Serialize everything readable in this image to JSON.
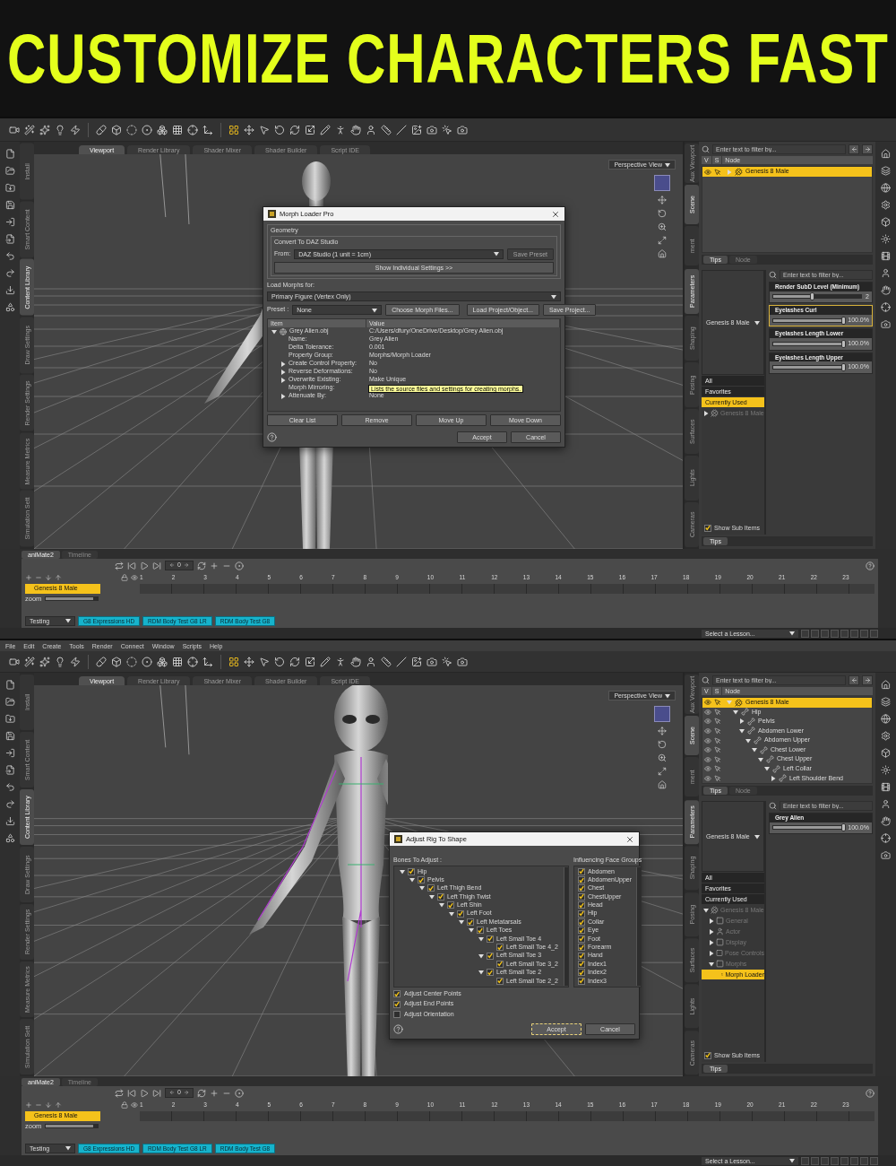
{
  "headline": "CUSTOMIZE CHARACTERS FAST",
  "screens": [
    {
      "left_tabs": [
        {
          "label": "Install",
          "selected": false
        },
        {
          "label": "Smart Content",
          "selected": false
        },
        {
          "label": "Content Library",
          "selected": true
        },
        {
          "label": "Draw Settings",
          "selected": false
        },
        {
          "label": "Render Settings",
          "selected": false
        },
        {
          "label": "Measure Metrics",
          "selected": false
        },
        {
          "label": "Simulation Sett",
          "selected": false
        }
      ],
      "viewport": {
        "tabs": [
          {
            "label": "Viewport",
            "selected": true
          },
          {
            "label": "Render Library",
            "selected": false
          },
          {
            "label": "Shader Mixer",
            "selected": false
          },
          {
            "label": "Shader Builder",
            "selected": false
          },
          {
            "label": "Script IDE",
            "selected": false
          }
        ],
        "view_label": "Perspective View",
        "kind": "human",
        "dialog": {
          "kind": "morph_loader",
          "title": "Morph Loader Pro",
          "geometry_label": "Geometry",
          "convert_label": "Convert To DAZ Studio",
          "from_label": "From:",
          "from_select": "DAZ Studio (1 unit = 1cm)",
          "save_preset": {
            "label": "Save Preset",
            "disabled": true
          },
          "show_settings": "Show Individual Settings >>",
          "load_for_label": "Load Morphs for:",
          "load_for_select": "Primary Figure (Vertex Only)",
          "preset_label": "Preset :",
          "preset_select": "None",
          "top_buttons": [
            "Choose Morph Files...",
            "Load Project/Object...",
            "Save Project..."
          ],
          "columns": [
            "Item",
            "Value"
          ],
          "rows": [
            {
              "item": "Grey Alien.obj",
              "value": "C:/Users/dfury/OneDrive/Desktop/Grey Alien.obj",
              "expanded": true,
              "children": [
                {
                  "item": "Name:",
                  "value": "Grey Alien"
                },
                {
                  "item": "Delta Tolerance:",
                  "value": "0.001"
                },
                {
                  "item": "Property Group:",
                  "value": "Morphs/Morph Loader"
                },
                {
                  "item": "Create Control Property:",
                  "value": "No",
                  "expanded": false
                },
                {
                  "item": "Reverse Deformations:",
                  "value": "No",
                  "expanded": false
                },
                {
                  "item": "Overwrite Existing:",
                  "value": "Make Unique",
                  "expanded": false
                },
                {
                  "item": "Morph Mirroring:"
                },
                {
                  "item": "Attenuate By:",
                  "value": "None",
                  "expanded": false
                }
              ]
            }
          ],
          "tooltip": "Lists the source files and settings for creating morphs.",
          "list_buttons": [
            "Clear List",
            "Remove",
            "Move Up",
            "Move Down"
          ],
          "accept": "Accept",
          "cancel": "Cancel"
        }
      },
      "right_panel": {
        "top_tabs": [
          {
            "label": "Aux Viewport",
            "selected": false
          },
          {
            "label": "Scene",
            "selected": true
          },
          {
            "label": "ment",
            "selected": false
          }
        ],
        "bottom_tabs": [
          {
            "label": "Parameters",
            "selected": true
          },
          {
            "label": "Shaping",
            "selected": false
          },
          {
            "label": "Posing",
            "selected": false
          },
          {
            "label": "Surfaces",
            "selected": false
          },
          {
            "label": "Lights",
            "selected": false
          },
          {
            "label": "Cameras",
            "selected": false
          }
        ],
        "scene": {
          "filter_placeholder": "Enter text to filter by...",
          "columns": [
            "V",
            "S",
            "Node"
          ],
          "nodes": [
            {
              "label": "Genesis 8 Male",
              "kind": "figure",
              "selected": true,
              "expanded": false
            }
          ]
        },
        "scene_tabs": [
          {
            "label": "Tips",
            "selected": true
          },
          {
            "label": "Node",
            "selected": false
          }
        ],
        "parameters": {
          "figure_select": "Genesis 8 Male",
          "categories": [
            {
              "label": "All",
              "selected": false
            },
            {
              "label": "Favorites",
              "selected": false
            },
            {
              "label": "Currently Used",
              "selected": true
            }
          ],
          "tree": [
            {
              "label": "Genesis 8 Male",
              "kind": "figure",
              "selected": false,
              "expanded": false
            }
          ],
          "filter_placeholder": "Enter text to filter by...",
          "sliders": [
            {
              "label": "Render SubD Level (Minimum)",
              "reading": "2",
              "level": 0.45,
              "selected": false
            },
            {
              "label": "Eyelashes Curl",
              "reading": "100.0%",
              "level": 1,
              "selected": true
            },
            {
              "label": "Eyelashes Length Lower",
              "reading": "100.0%",
              "level": 1,
              "selected": false
            },
            {
              "label": "Eyelashes Length Upper",
              "reading": "100.0%",
              "level": 1,
              "selected": false
            }
          ],
          "show_sub_items": {
            "label": "Show Sub Items",
            "checked": true
          },
          "bottom_tab": "Tips"
        }
      },
      "timeline": {
        "tabs": [
          {
            "label": "aniMate2",
            "selected": true
          },
          {
            "label": "Timeline",
            "selected": false
          }
        ],
        "frame": "0",
        "ticks": [
          "1",
          "2",
          "3",
          "4",
          "5",
          "6",
          "7",
          "8",
          "9",
          "10",
          "11",
          "12",
          "13",
          "14",
          "15",
          "16",
          "17",
          "18",
          "19",
          "20",
          "21",
          "22",
          "23"
        ],
        "track": "Genesis 8 Male",
        "zoom": {
          "label": "zoom",
          "level": 0.9
        },
        "set_select": "Testing",
        "clips": [
          "G8 Expressions HD",
          "RDM Body Test G8 LR",
          "RDM Body Test G8"
        ]
      },
      "status": {
        "lesson_select": "Select a Lesson..."
      }
    },
    {
      "menu": [
        "File",
        "Edit",
        "Create",
        "Tools",
        "Render",
        "Connect",
        "Window",
        "Scripts",
        "Help"
      ],
      "left_tabs": [
        {
          "label": "Install",
          "selected": false
        },
        {
          "label": "Smart Content",
          "selected": false
        },
        {
          "label": "Content Library",
          "selected": true
        },
        {
          "label": "Draw Settings",
          "selected": false
        },
        {
          "label": "Render Settings",
          "selected": false
        },
        {
          "label": "Measure Metrics",
          "selected": false
        },
        {
          "label": "Simulation Sett",
          "selected": false
        }
      ],
      "viewport": {
        "tabs": [
          {
            "label": "Viewport",
            "selected": true
          },
          {
            "label": "Render Library",
            "selected": false
          },
          {
            "label": "Shader Mixer",
            "selected": false
          },
          {
            "label": "Shader Builder",
            "selected": false
          },
          {
            "label": "Script IDE",
            "selected": false
          }
        ],
        "view_label": "Perspective View",
        "kind": "alien",
        "dialog": {
          "kind": "adjust_rig",
          "title": "Adjust Rig To Shape",
          "bones_label": "Bones To Adjust :",
          "bones": [
            {
              "label": "Hip",
              "checked": true,
              "expanded": true,
              "children": [
                {
                  "label": "Pelvis",
                  "checked": true,
                  "expanded": true,
                  "children": [
                    {
                      "label": "Left Thigh Bend",
                      "checked": true,
                      "expanded": true,
                      "children": [
                        {
                          "label": "Left Thigh Twist",
                          "checked": true,
                          "expanded": true,
                          "children": [
                            {
                              "label": "Left Shin",
                              "checked": true,
                              "expanded": true,
                              "children": [
                                {
                                  "label": "Left Foot",
                                  "checked": true,
                                  "expanded": true,
                                  "children": [
                                    {
                                      "label": "Left Metatarsals",
                                      "checked": true,
                                      "expanded": true,
                                      "children": [
                                        {
                                          "label": "Left Toes",
                                          "checked": true,
                                          "expanded": true,
                                          "children": [
                                            {
                                              "label": "Left Small Toe 4",
                                              "checked": true,
                                              "expanded": true,
                                              "children": [
                                                {
                                                  "label": "Left Small Toe 4_2",
                                                  "checked": true
                                                }
                                              ]
                                            },
                                            {
                                              "label": "Left Small Toe 3",
                                              "checked": true,
                                              "expanded": true,
                                              "children": [
                                                {
                                                  "label": "Left Small Toe 3_2",
                                                  "checked": true
                                                }
                                              ]
                                            },
                                            {
                                              "label": "Left Small Toe 2",
                                              "checked": true,
                                              "expanded": true,
                                              "children": [
                                                {
                                                  "label": "Left Small Toe 2_2",
                                                  "checked": true
                                                }
                                              ]
                                            }
                                          ]
                                        }
                                      ]
                                    }
                                  ]
                                }
                              ]
                            }
                          ]
                        }
                      ]
                    }
                  ]
                }
              ]
            }
          ],
          "groups_label": "Influencing Face Groups",
          "groups": [
            {
              "label": "Abdomen",
              "checked": true
            },
            {
              "label": "AbdomenUpper",
              "checked": true
            },
            {
              "label": "Chest",
              "checked": true
            },
            {
              "label": "ChestUpper",
              "checked": true
            },
            {
              "label": "Head",
              "checked": true
            },
            {
              "label": "Hip",
              "checked": true
            },
            {
              "label": "Collar",
              "checked": true
            },
            {
              "label": "Eye",
              "checked": true
            },
            {
              "label": "Foot",
              "checked": true
            },
            {
              "label": "Forearm",
              "checked": true
            },
            {
              "label": "Hand",
              "checked": true
            },
            {
              "label": "Index1",
              "checked": true
            },
            {
              "label": "Index2",
              "checked": true
            },
            {
              "label": "Index3",
              "checked": true
            }
          ],
          "options": [
            {
              "label": "Adjust Center Points",
              "checked": true
            },
            {
              "label": "Adjust End Points",
              "checked": true
            },
            {
              "label": "Adjust Orientation",
              "checked": false
            }
          ],
          "accept": "Accept",
          "cancel": "Cancel"
        }
      },
      "right_panel": {
        "top_tabs": [
          {
            "label": "Aux Viewport",
            "selected": false
          },
          {
            "label": "Scene",
            "selected": true
          },
          {
            "label": "ment",
            "selected": false
          }
        ],
        "bottom_tabs": [
          {
            "label": "Parameters",
            "selected": true
          },
          {
            "label": "Shaping",
            "selected": false
          },
          {
            "label": "Posing",
            "selected": false
          },
          {
            "label": "Surfaces",
            "selected": false
          },
          {
            "label": "Lights",
            "selected": false
          },
          {
            "label": "Cameras",
            "selected": false
          }
        ],
        "scene": {
          "filter_placeholder": "Enter text to filter by...",
          "columns": [
            "V",
            "S",
            "Node"
          ],
          "nodes": [
            {
              "label": "Genesis 8 Male",
              "kind": "figure",
              "selected": true,
              "expanded": true,
              "children": [
                {
                  "label": "Hip",
                  "kind": "bone",
                  "selected": false,
                  "expanded": true,
                  "children": [
                    {
                      "label": "Pelvis",
                      "kind": "bone",
                      "selected": false,
                      "expanded": false
                    },
                    {
                      "label": "Abdomen Lower",
                      "kind": "bone",
                      "selected": false,
                      "expanded": true,
                      "children": [
                        {
                          "label": "Abdomen Upper",
                          "kind": "bone",
                          "selected": false,
                          "expanded": true,
                          "children": [
                            {
                              "label": "Chest Lower",
                              "kind": "bone",
                              "selected": false,
                              "expanded": true,
                              "children": [
                                {
                                  "label": "Chest Upper",
                                  "kind": "bone",
                                  "selected": false,
                                  "expanded": true,
                                  "children": [
                                    {
                                      "label": "Left Collar",
                                      "kind": "bone",
                                      "selected": false,
                                      "expanded": true,
                                      "children": [
                                        {
                                          "label": "Left Shoulder Bend",
                                          "kind": "bone",
                                          "selected": false,
                                          "expanded": false
                                        }
                                      ]
                                    }
                                  ]
                                }
                              ]
                            }
                          ]
                        }
                      ]
                    }
                  ]
                }
              ]
            }
          ]
        },
        "scene_tabs": [
          {
            "label": "Tips",
            "selected": true
          },
          {
            "label": "Node",
            "selected": false
          }
        ],
        "parameters": {
          "figure_select": "Genesis 8 Male",
          "categories": [
            {
              "label": "All",
              "selected": false
            },
            {
              "label": "Favorites",
              "selected": false
            },
            {
              "label": "Currently Used",
              "selected": false
            }
          ],
          "tree": [
            {
              "label": "Genesis 8 Male",
              "kind": "figure",
              "selected": false,
              "expanded": true,
              "children": [
                {
                  "label": "General",
                  "kind": "group",
                  "selected": false,
                  "expanded": false
                },
                {
                  "label": "Actor",
                  "kind": "actor",
                  "selected": false,
                  "expanded": false
                },
                {
                  "label": "Display",
                  "kind": "group",
                  "selected": false,
                  "expanded": false
                },
                {
                  "label": "Pose Controls",
                  "kind": "group",
                  "selected": false,
                  "expanded": false
                },
                {
                  "label": "Morphs",
                  "kind": "group",
                  "selected": false,
                  "expanded": true,
                  "children": [
                    {
                      "label": "Morph Loader",
                      "kind": "group",
                      "selected": true
                    }
                  ]
                }
              ]
            }
          ],
          "filter_placeholder": "Enter text to filter by...",
          "sliders": [
            {
              "label": "Grey Alien",
              "reading": "100.0%",
              "level": 1,
              "selected": false
            }
          ],
          "show_sub_items": {
            "label": "Show Sub Items",
            "checked": true
          },
          "bottom_tab": "Tips"
        }
      },
      "timeline": {
        "tabs": [
          {
            "label": "aniMate2",
            "selected": true
          },
          {
            "label": "Timeline",
            "selected": false
          }
        ],
        "frame": "0",
        "ticks": [
          "1",
          "2",
          "3",
          "4",
          "5",
          "6",
          "7",
          "8",
          "9",
          "10",
          "11",
          "12",
          "13",
          "14",
          "15",
          "16",
          "17",
          "18",
          "19",
          "20",
          "21",
          "22",
          "23"
        ],
        "track": "Genesis 8 Male",
        "zoom": {
          "label": "zoom",
          "level": 0.9
        },
        "set_select": "Testing",
        "clips": [
          "G8 Expressions HD",
          "RDM Body Test G8 LR",
          "RDM Body Test G8"
        ]
      },
      "status": {
        "lesson_select": "Select a Lesson..."
      }
    }
  ]
}
